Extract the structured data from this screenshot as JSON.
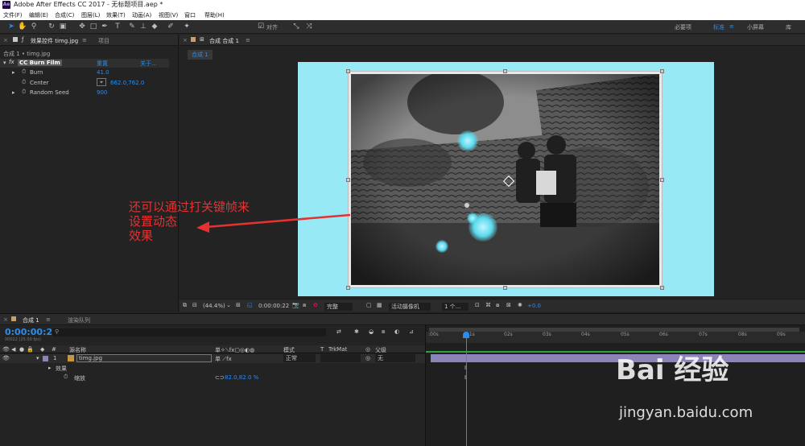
{
  "window": {
    "title": "Adobe After Effects CC 2017 - 无标题项目.aep *",
    "app_badge": "Ae"
  },
  "menu": [
    "文件(F)",
    "编辑(E)",
    "合成(C)",
    "图层(L)",
    "效果(T)",
    "动画(A)",
    "视图(V)",
    "窗口",
    "帮助(H)"
  ],
  "toolbar": {
    "snap_label": "对齐",
    "workspaces": [
      "必要项",
      "标准",
      "小屏幕",
      "库"
    ],
    "active_workspace": "标准"
  },
  "effects_panel": {
    "tab_label": "效果控件 timg.jpg",
    "tab2_label": "项目",
    "breadcrumb": "合成 1 • timg.jpg",
    "effect": {
      "name": "CC Burn Film",
      "reset": "重置",
      "about": "关于..."
    },
    "props": [
      {
        "name": "Burn",
        "value": "41.0"
      },
      {
        "name": "Center",
        "value": "662.0,762.0"
      },
      {
        "name": "Random Seed",
        "value": "900"
      }
    ]
  },
  "comp_panel": {
    "tab_label": "合成 合成 1",
    "sub_tab": "合成 1"
  },
  "viewer_bar": {
    "zoom": "(44.4%)",
    "time": "0:00:00:22",
    "quality": "完整",
    "camera": "活动摄像机",
    "views": "1 个...",
    "exposure": "+0.0"
  },
  "annotation": [
    "还可以通过打关键帧来",
    "设置动态",
    "效果"
  ],
  "timeline": {
    "tab_label": "合成 1",
    "tab2_label": "渲染队列",
    "timecode": "0:00:00:22",
    "frame_info": "00022 (25.00 fps)",
    "columns": {
      "source": "源名称",
      "mode": "模式",
      "trkmat": "TrkMat",
      "parent": "父级"
    },
    "layer": {
      "index": "1",
      "name": "timg.jpg",
      "mode": "正常",
      "parent": "无"
    },
    "effects_label": "效果",
    "scale": {
      "label": "缩放",
      "value": "82.0,82.0 %"
    },
    "ruler_ticks": [
      ":00s",
      "01s",
      "02s",
      "03s",
      "04s",
      "05s",
      "06s",
      "07s",
      "08s",
      "09s"
    ]
  },
  "watermark": {
    "line1": "Bai 经验",
    "line2": "jingyan.baidu.com"
  },
  "colors": {
    "accent": "#2d8ceb",
    "viewer_bg": "#97eaf5",
    "annotation": "#e53131",
    "layer_bar": "#8b84b8"
  }
}
